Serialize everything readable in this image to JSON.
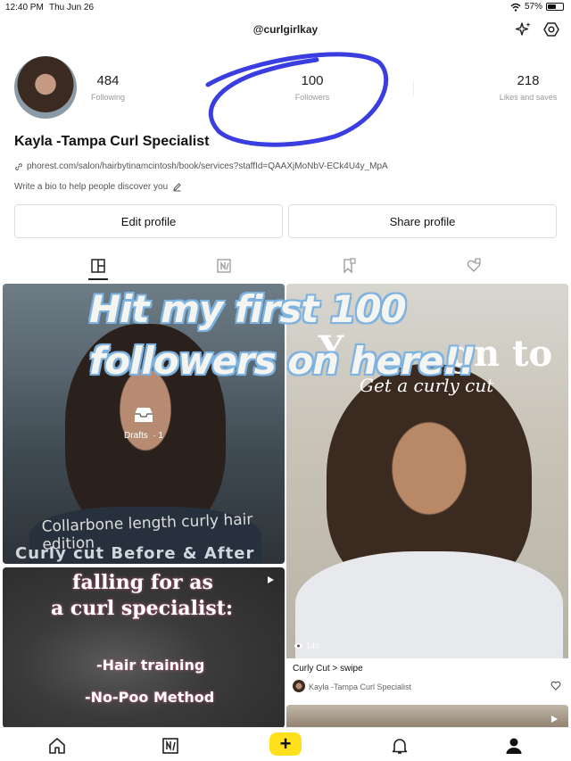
{
  "status_bar": {
    "time": "12:40 PM",
    "date": "Thu Jun 26",
    "battery": "57%",
    "battery_fraction": 0.57
  },
  "header": {
    "handle": "@curlgirlkay",
    "sparkle_icon": "sparkle-icon",
    "settings_icon": "settings-icon"
  },
  "profile": {
    "name": "Kayla -Tampa Curl Specialist",
    "link": "phorest.com/salon/hairbytinamcintosh/book/services?staffId=QAAXjMoNbV-ECk4U4y_MpA",
    "bio_placeholder": "Write a bio to help people discover you",
    "stats": [
      {
        "value": "484",
        "label": "Following"
      },
      {
        "value": "100",
        "label": "Followers"
      },
      {
        "value": "218",
        "label": "Likes and saves"
      }
    ]
  },
  "buttons": {
    "edit": "Edit profile",
    "share": "Share profile"
  },
  "tabs": [
    "posts-tab-icon",
    "notes-tab-icon",
    "saved-tab-icon",
    "liked-tab-icon"
  ],
  "overlay_caption": {
    "line1": "Hit my first 100",
    "line2": "followers on here!!"
  },
  "posts": [
    {
      "drafts_label": "Drafts",
      "drafts_count": "· 1",
      "text_a": "Collarbone length curly hair edition",
      "text_b": "Curly cut Before & After"
    },
    {
      "text_a": "Y",
      "text_b": "gn to",
      "text_c": "Get a curly cut",
      "views": "140",
      "title": "Curly Cut > swipe",
      "author": "Kayla -Tampa Curl Specialist"
    },
    {
      "lines": [
        "falling for as",
        "a curl specialist:",
        "-Hair training",
        "-No-Poo Method"
      ]
    }
  ],
  "colors": {
    "accent_yellow": "#ffe01b",
    "annotation_blue": "#3a3ee0"
  }
}
